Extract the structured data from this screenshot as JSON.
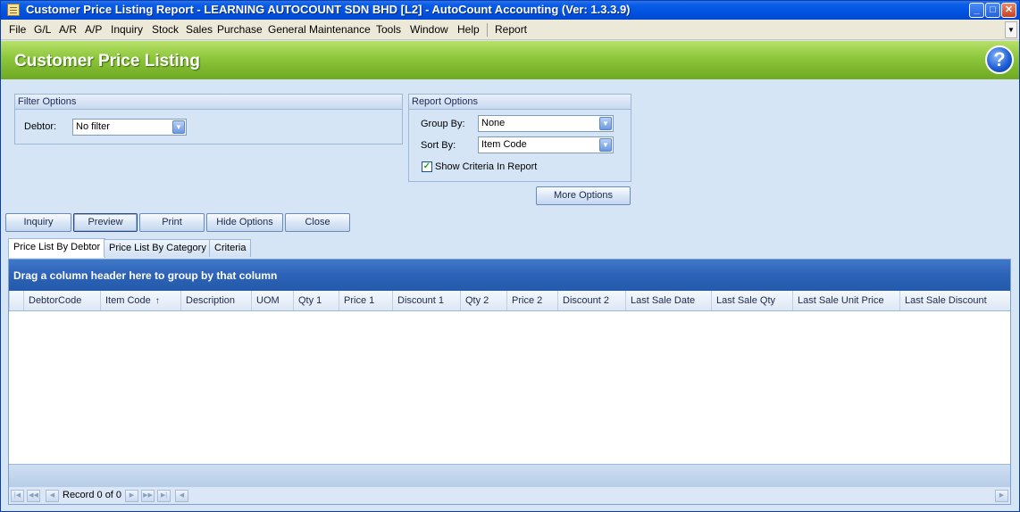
{
  "window": {
    "title": "Customer Price Listing Report - LEARNING AUTOCOUNT SDN BHD [L2] - AutoCount Accounting (Ver: 1.3.3.9)",
    "minimize": "_",
    "maximize": "□",
    "close": "✕"
  },
  "menu": {
    "items": [
      "File",
      "G/L",
      "A/R",
      "A/P",
      "Inquiry",
      "Stock",
      "Sales",
      "Purchase",
      "General Maintenance",
      "Tools",
      "Window",
      "Help",
      "Report"
    ],
    "scroll_glyph": "▼"
  },
  "header": {
    "title": "Customer Price Listing",
    "help_glyph": "?"
  },
  "filter": {
    "title": "Filter Options",
    "debtor_label": "Debtor:",
    "debtor_value": "No filter"
  },
  "report_options": {
    "title": "Report Options",
    "group_by_label": "Group By:",
    "group_by_value": "None",
    "sort_by_label": "Sort By:",
    "sort_by_value": "Item Code",
    "show_criteria_label": "Show Criteria In Report",
    "show_criteria_checked": true,
    "checkmark": "✓"
  },
  "buttons": {
    "more_options": "More Options",
    "inquiry": "Inquiry",
    "preview": "Preview",
    "print": "Print",
    "hide_options": "Hide Options",
    "close": "Close"
  },
  "tabs": [
    "Price List By Debtor",
    "Price List By Category",
    "Criteria"
  ],
  "grid": {
    "group_hint": "Drag a column header here to group by that column",
    "columns": [
      "DebtorCode",
      "Item Code",
      "Description",
      "UOM",
      "Qty 1",
      "Price 1",
      "Discount 1",
      "Qty 2",
      "Price 2",
      "Discount 2",
      "Last Sale Date",
      "Last Sale Qty",
      "Last Sale Unit Price",
      "Last Sale Discount"
    ],
    "sort_arrow": "↑",
    "rows": []
  },
  "navigator": {
    "record_text": "Record 0 of 0"
  },
  "colors": {
    "header_green": "#8cc63a",
    "titlebar_blue": "#0052e0",
    "group_panel_blue": "#2d62b8"
  }
}
